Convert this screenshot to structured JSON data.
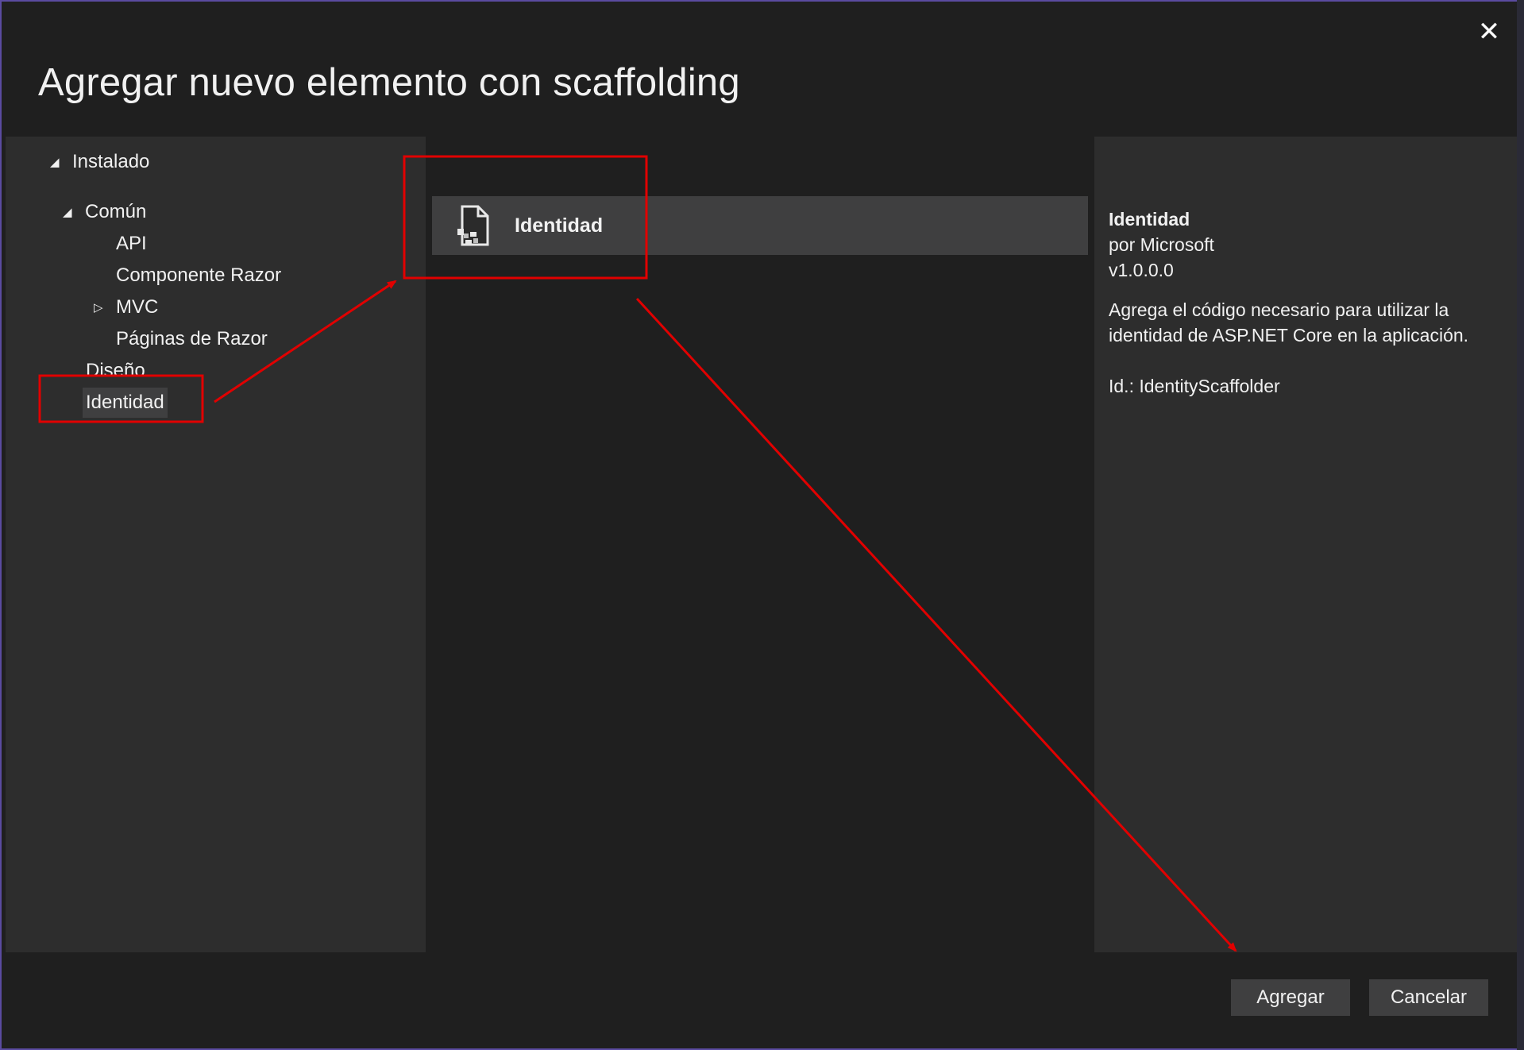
{
  "dialog": {
    "title": "Agregar nuevo elemento con scaffolding",
    "close_glyph": "✕"
  },
  "tree": {
    "root": {
      "label": "Instalado",
      "expander": "◢"
    },
    "common": {
      "label": "Común",
      "expander": "◢"
    },
    "items": [
      {
        "label": "API"
      },
      {
        "label": "Componente Razor"
      },
      {
        "label": "MVC",
        "expander": "▷"
      },
      {
        "label": "Páginas de Razor"
      }
    ],
    "design": {
      "label": "Diseño"
    },
    "identity": {
      "label": "Identidad"
    }
  },
  "templates": [
    {
      "label": "Identidad",
      "icon": "document-file-icon"
    }
  ],
  "details": {
    "title": "Identidad",
    "author": "por Microsoft",
    "version": "v1.0.0.0",
    "description": "Agrega el código necesario para utilizar la identidad de ASP.NET Core en la aplicación.",
    "id": "Id.: IdentityScaffolder"
  },
  "footer": {
    "add_label": "Agregar",
    "cancel_label": "Cancelar"
  },
  "annotation_color": "#e10000"
}
